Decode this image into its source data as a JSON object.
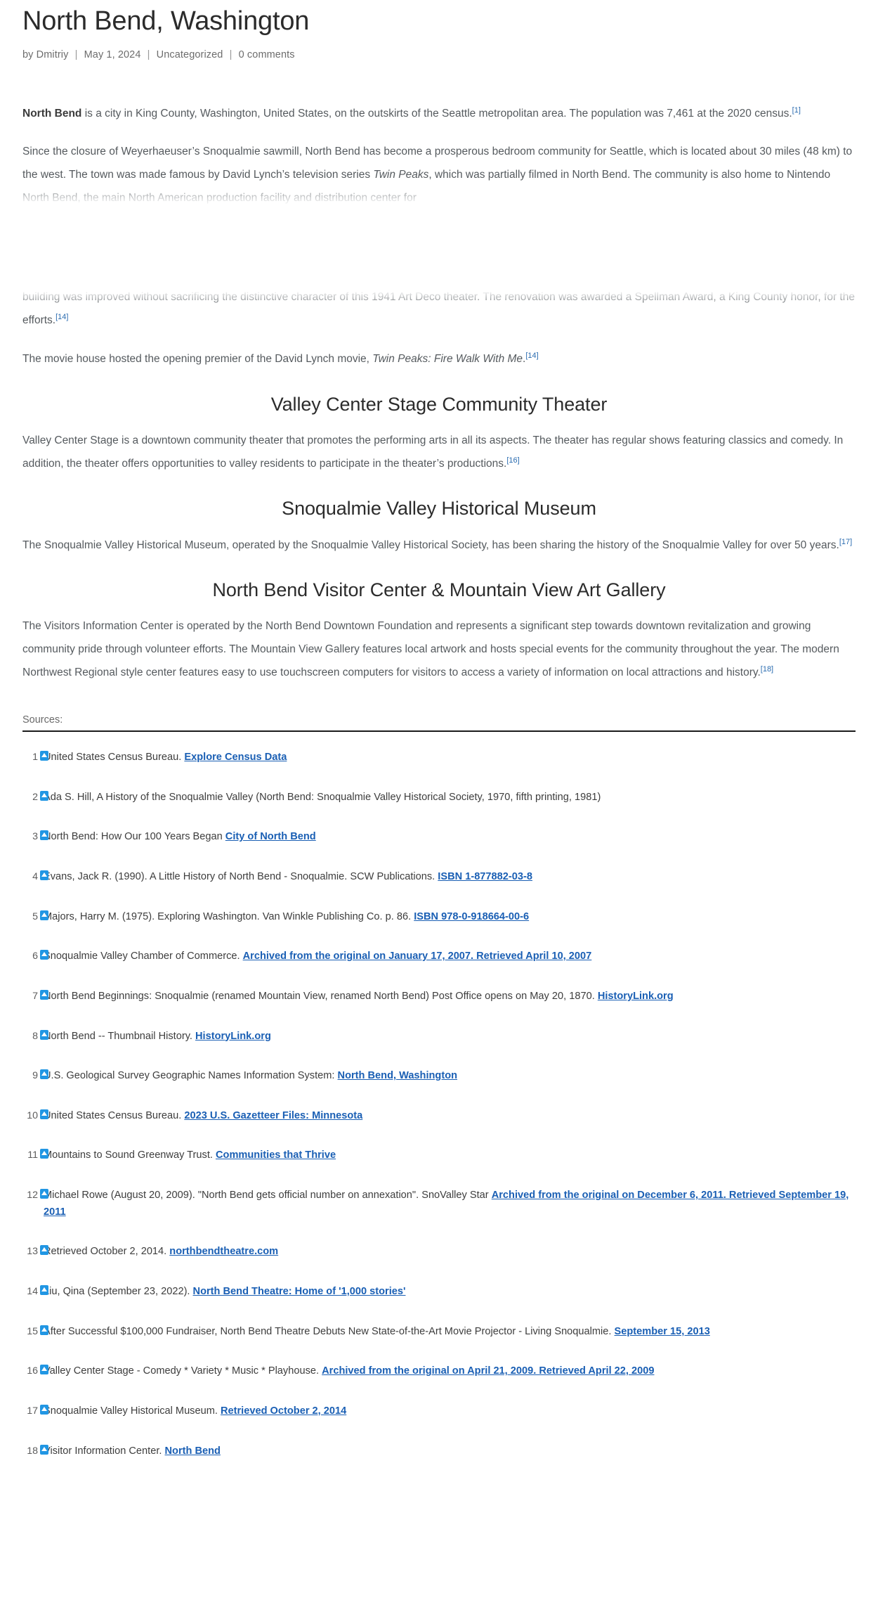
{
  "post": {
    "title": "North Bend, Washington",
    "meta": {
      "author": "by Dmitriy",
      "date": "May 1, 2024",
      "category": "Uncategorized",
      "comments": "0 comments",
      "separator": "|"
    }
  },
  "article": {
    "p1_lead": "North Bend",
    "p1_rest": " is a city in King County, Washington, United States, on the outskirts of the Seattle metropolitan area. The population was 7,461 at the 2020 census.",
    "p1_ref": "[1]",
    "p2_a": "Since the closure of Weyerhaeuser’s Snoqualmie sawmill, North Bend has become a prosperous bedroom community for Seattle, which is located about 30 miles (48 km) to the west. The town was made famous by David Lynch’s television series ",
    "p2_italic": "Twin Peaks",
    "p2_b": ", which was partially filmed in North Bend. The community is also home to Nintendo North Bend, the main North American production facility and distribution center for",
    "p3": "building was improved without sacrificing the distinctive character of this 1941 Art Deco theater. The renovation was awarded a Spellman Award, a King County honor, for the efforts.",
    "p3_ref": "[14]",
    "p4_a": "The movie house hosted the opening premier of the David Lynch movie, ",
    "p4_italic": "Twin Peaks: Fire Walk With Me",
    "p4_b": ".",
    "p4_ref": "[14]"
  },
  "sections": [
    {
      "heading": "Valley Center Stage Community Theater",
      "body": "Valley Center Stage is a downtown community theater that promotes the performing arts in all its aspects. The theater has regular shows featuring classics and comedy. In addition, the theater offers opportunities to valley residents to participate in the theater’s productions.",
      "ref": "[16]"
    },
    {
      "heading": "Snoqualmie Valley Historical Museum",
      "body": "The Snoqualmie Valley Historical Museum, operated by the Snoqualmie Valley Historical Society, has been sharing the history of the Snoqualmie Valley for over 50 years.",
      "ref": "[17]"
    },
    {
      "heading": "North Bend Visitor Center & Mountain View Art Gallery",
      "body": "The Visitors Information Center is operated by the North Bend Downtown Foundation and represents a significant step towards downtown revitalization and growing community pride through volunteer efforts. The Mountain View Gallery features local artwork and hosts special events for the community throughout the year. The modern Northwest Regional style center features easy to use touchscreen computers for visitors to access a variety of information on local attractions and history.",
      "ref": "[18]"
    }
  ],
  "sources": {
    "label": "Sources:",
    "backref_icon": "up-arrow-icon",
    "items": [
      {
        "num": "1",
        "text": "United States Census Bureau. ",
        "link": "Explore Census Data",
        "tail": ""
      },
      {
        "num": "2",
        "text": "Ada S. Hill, A History of the Snoqualmie Valley (North Bend: Snoqualmie Valley Historical Society, 1970, fifth printing, 1981)",
        "link": "",
        "tail": ""
      },
      {
        "num": "3",
        "text": "North Bend: How Our 100 Years Began ",
        "link": "City of North Bend",
        "tail": ""
      },
      {
        "num": "4",
        "text": "Evans, Jack R. (1990). A Little History of North Bend - Snoqualmie. SCW Publications. ",
        "link": "ISBN 1-877882-03-8",
        "tail": ""
      },
      {
        "num": "5",
        "text": "Majors, Harry M. (1975). Exploring Washington. Van Winkle Publishing Co. p. 86. ",
        "link": "ISBN 978-0-918664-00-6",
        "tail": ""
      },
      {
        "num": "6",
        "text": "Snoqualmie Valley Chamber of Commerce. ",
        "link": "Archived from the original on January 17, 2007. Retrieved April 10, 2007",
        "tail": ""
      },
      {
        "num": "7",
        "text": "North Bend Beginnings: Snoqualmie (renamed Mountain View, renamed North Bend) Post Office opens on May 20, 1870. ",
        "link": "HistoryLink.org",
        "tail": ""
      },
      {
        "num": "8",
        "text": "North Bend -- Thumbnail History. ",
        "link": "HistoryLink.org",
        "tail": ""
      },
      {
        "num": "9",
        "text": "U.S. Geological Survey Geographic Names Information System: ",
        "link": "North Bend, Washington",
        "tail": ""
      },
      {
        "num": "10",
        "text": "United States Census Bureau. ",
        "link": "2023 U.S. Gazetteer Files: Minnesota",
        "tail": ""
      },
      {
        "num": "11",
        "text": "Mountains to Sound Greenway Trust. ",
        "link": "Communities that Thrive",
        "tail": ""
      },
      {
        "num": "12",
        "text": "Michael Rowe (August 20, 2009). \"North Bend gets official number on annexation\". SnoValley Star ",
        "link": "Archived from the original on December 6, 2011. Retrieved September 19, 2011",
        "tail": ""
      },
      {
        "num": "13",
        "text": "Retrieved October 2, 2014. ",
        "link": "northbendtheatre.com",
        "tail": ""
      },
      {
        "num": "14",
        "text": "Liu, Qina (September 23, 2022). ",
        "link": "North Bend Theatre: Home of '1,000 stories'",
        "tail": ""
      },
      {
        "num": "15",
        "text": "After Successful $100,000 Fundraiser, North Bend Theatre Debuts New State-of-the-Art Movie Projector - Living Snoqualmie. ",
        "link": "September 15, 2013",
        "tail": ""
      },
      {
        "num": "16",
        "text": "Valley Center Stage - Comedy * Variety * Music * Playhouse. ",
        "link": "Archived from the original on April 21, 2009. Retrieved April 22, 2009",
        "tail": ""
      },
      {
        "num": "17",
        "text": "Snoqualmie Valley Historical Museum. ",
        "link": "Retrieved October 2, 2014",
        "tail": ""
      },
      {
        "num": "18",
        "text": "Visitor Information Center. ",
        "link": "North Bend",
        "tail": ""
      }
    ]
  }
}
